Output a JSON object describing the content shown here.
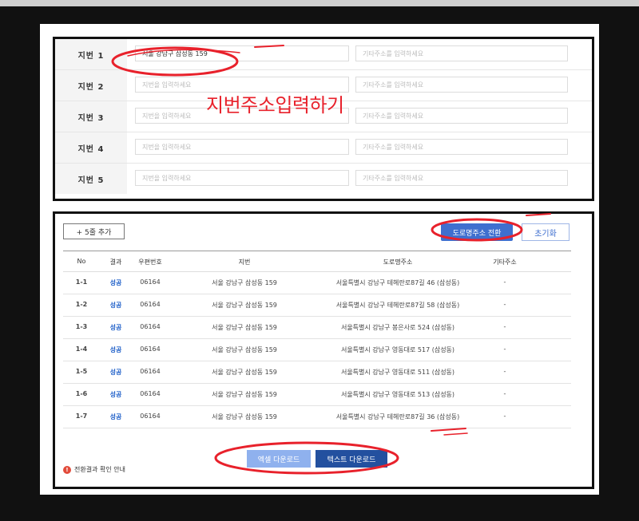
{
  "lot_panel": {
    "rows": [
      {
        "label": "지번 1",
        "lot_value": "서울 강남구 삼성동 159",
        "extra_placeholder": "기타주소를 입력하세요"
      },
      {
        "label": "지번 2",
        "lot_placeholder": "지번을 입력하세요",
        "extra_placeholder": "기타주소를 입력하세요"
      },
      {
        "label": "지번 3",
        "lot_placeholder": "지번을 입력하세요",
        "extra_placeholder": "기타주소를 입력하세요"
      },
      {
        "label": "지번 4",
        "lot_placeholder": "지번을 입력하세요",
        "extra_placeholder": "기타주소를 입력하세요"
      },
      {
        "label": "지번 5",
        "lot_placeholder": "지번을 입력하세요",
        "extra_placeholder": "기타주소를 입력하세요"
      }
    ]
  },
  "annotation": {
    "text": "지번주소입력하기",
    "color": "#e8212b"
  },
  "toolbar": {
    "add_label": "+ 5줄 추가",
    "convert_label": "도로명주소 전환",
    "reset_label": "초기화"
  },
  "table": {
    "headers": [
      "No",
      "결과",
      "우편번호",
      "지번",
      "도로명주소",
      "기타주소"
    ],
    "rows": [
      [
        "1-1",
        "성공",
        "06164",
        "서울 강남구 삼성동 159",
        "서울특별시 강남구 테헤란로87길 46 (삼성동)",
        "-"
      ],
      [
        "1-2",
        "성공",
        "06164",
        "서울 강남구 삼성동 159",
        "서울특별시 강남구 테헤란로87길 58 (삼성동)",
        "-"
      ],
      [
        "1-3",
        "성공",
        "06164",
        "서울 강남구 삼성동 159",
        "서울특별시 강남구 봉은사로 524 (삼성동)",
        "-"
      ],
      [
        "1-4",
        "성공",
        "06164",
        "서울 강남구 삼성동 159",
        "서울특별시 강남구 영동대로 517 (삼성동)",
        "-"
      ],
      [
        "1-5",
        "성공",
        "06164",
        "서울 강남구 삼성동 159",
        "서울특별시 강남구 영동대로 511 (삼성동)",
        "-"
      ],
      [
        "1-6",
        "성공",
        "06164",
        "서울 강남구 삼성동 159",
        "서울특별시 강남구 영동대로 513 (삼성동)",
        "-"
      ],
      [
        "1-7",
        "성공",
        "06164",
        "서울 강남구 삼성동 159",
        "서울특별시 강남구 테헤란로87길 36 (삼성동)",
        "-"
      ]
    ]
  },
  "footer": {
    "excel_label": "엑셀 다운로드",
    "text_label": "텍스트 다운로드",
    "info_label": "전환결과 확인 안내",
    "info_icon": "!"
  },
  "colors": {
    "accent": "#3f6fcf",
    "success": "#1d5ec8",
    "highlight": "#e8212b"
  }
}
